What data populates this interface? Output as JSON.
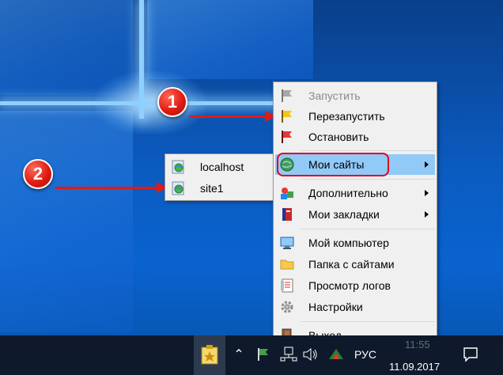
{
  "menu": {
    "items": [
      {
        "label": "Запустить",
        "icon": "flag-gray-icon",
        "disabled": true
      },
      {
        "label": "Перезапустить",
        "icon": "flag-yellow-icon"
      },
      {
        "label": "Остановить",
        "icon": "flag-red-icon"
      },
      {
        "label": "Мои сайты",
        "icon": "globe-icon",
        "submenu": true,
        "highlighted": true
      },
      {
        "label": "Дополнительно",
        "icon": "blocks-icon",
        "submenu": true
      },
      {
        "label": "Мои закладки",
        "icon": "bookmarks-icon",
        "submenu": true
      },
      {
        "label": "Мой компьютер",
        "icon": "computer-icon"
      },
      {
        "label": "Папка с сайтами",
        "icon": "folder-icon"
      },
      {
        "label": "Просмотр логов",
        "icon": "log-icon"
      },
      {
        "label": "Настройки",
        "icon": "gear-icon"
      },
      {
        "label": "Выход",
        "icon": "exit-door-icon"
      }
    ]
  },
  "submenu": {
    "items": [
      {
        "label": "localhost",
        "icon": "site-globe-icon"
      },
      {
        "label": "site1",
        "icon": "site-globe-icon"
      }
    ]
  },
  "badges": {
    "first": "1",
    "second": "2"
  },
  "taskbar": {
    "language": "РУС",
    "time": "11:55",
    "date": "11.09.2017"
  },
  "colors": {
    "highlight": "#91c9f7",
    "annotation_red": "#e21a13",
    "menu_bg": "#f0f0f0"
  }
}
